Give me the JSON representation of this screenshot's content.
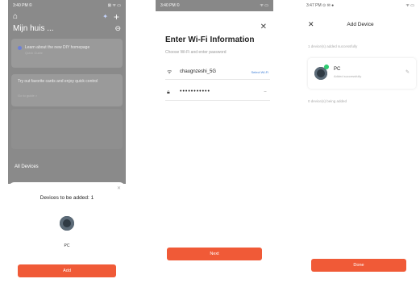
{
  "screen1": {
    "status_time": "3:40 PM ©",
    "status_icons": "⊠ ᯤ ▭",
    "home_title": "Mijn huis ...",
    "banner_text": "Learn about the new DIY homepage",
    "banner_sub": "Quick Guide",
    "tip_text": "Try out favorite cards and enjoy quick control",
    "tip_link": "Go to guide >",
    "devices_row": "All Devices",
    "sheet_title": "Devices to be added: 1",
    "device_label": "PC",
    "add_button": "Add"
  },
  "screen2": {
    "status_time": "3:40 PM ©",
    "status_icons": "ᯤ ▭",
    "title": "Enter Wi-Fi Information",
    "subtitle": "Choose Wi-Fi and enter password",
    "wifi_name": "chaugnzeshi_5G",
    "select_link": "Select Wi-Fi",
    "password_mask": "•••••••••••",
    "next_button": "Next"
  },
  "screen3": {
    "status_time": "3:47 PM ⊙ ✉ ●",
    "status_icons": "ᯤ ▭",
    "title": "Add Device",
    "section_label": "1 device(s) added successfully",
    "device_name": "PC",
    "device_status": "Added successfully",
    "failed_label": "0 device(s) being added",
    "done_button": "Done"
  },
  "colors": {
    "accent": "#f05a37",
    "overlay": "#8a8a8a",
    "success": "#2ecc71",
    "link": "#3a7bd5"
  },
  "icons": [
    "home-icon",
    "pin-icon",
    "add-icon",
    "more-icon",
    "close-icon",
    "wifi-icon",
    "lock-icon",
    "eye-off-icon",
    "edit-icon",
    "check-icon"
  ]
}
